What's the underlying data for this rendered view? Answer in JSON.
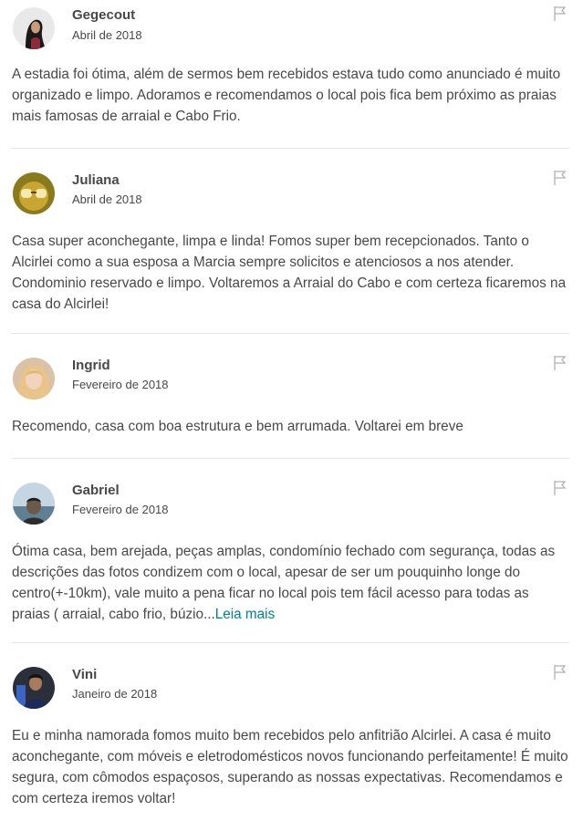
{
  "reviews": [
    {
      "name": "Gegecout",
      "date": "Abril de 2018",
      "text": "A estadia foi ótima, além de sermos bem recebidos estava tudo como anunciado é muito organizado e limpo. Adoramos e recomendamos o local pois fica bem próximo as praias mais famosas de arraial e Cabo Frio.",
      "read_more": ""
    },
    {
      "name": "Juliana",
      "date": "Abril de 2018",
      "text": "Casa super aconchegante, limpa e linda! Fomos super bem recepcionados. Tanto o Alcirlei como a sua esposa a Marcia sempre solicitos e atenciosos a nos atender. Condominio reservado e limpo. Voltaremos a Arraial do Cabo e com certeza ficaremos na casa do Alcirlei!",
      "read_more": ""
    },
    {
      "name": "Ingrid",
      "date": "Fevereiro de 2018",
      "text": "Recomendo, casa com boa estrutura e bem arrumada. Voltarei em breve",
      "read_more": ""
    },
    {
      "name": "Gabriel",
      "date": "Fevereiro de 2018",
      "text": "Ótima casa, bem arejada, peças amplas, condomínio fechado com segurança, todas as descrições das fotos condizem com o local, apesar de ser um pouquinho longe do centro(+-10km), vale muito a pena ficar no local pois tem fácil acesso para todas as praias ( arraial, cabo frio, búzio...",
      "read_more": "Leia mais"
    },
    {
      "name": "Vini",
      "date": "Janeiro de 2018",
      "text": "Eu e minha namorada fomos muito bem recebidos pelo anfitrião Alcirlei. A casa é muito aconchegante, com móveis e eletrodomésticos novos funcionando perfeitamente! É muito segura, com cômodos espaçosos, superando as nossas expectativas. Recomendamos e com certeza iremos voltar!",
      "read_more": ""
    }
  ],
  "icons": {
    "flag": "flag-icon",
    "avatar": "avatar"
  },
  "colors": {
    "text": "#484848",
    "link": "#008489",
    "divider": "#e4e4e4",
    "flag": "#b0b0b0"
  }
}
